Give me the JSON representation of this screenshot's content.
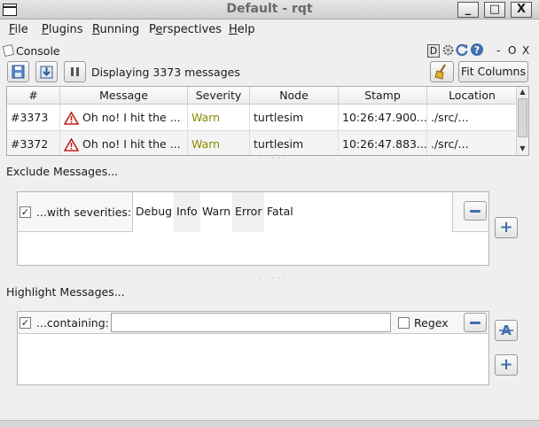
{
  "window": {
    "title": "Default - rqt",
    "minimize": "_",
    "maximize": "□",
    "close": "X"
  },
  "menu": [
    {
      "label": "File",
      "mnemonic": "F",
      "rest": "ile"
    },
    {
      "label": "Plugins",
      "mnemonic": "P",
      "rest": "lugins"
    },
    {
      "label": "Running",
      "mnemonic": "R",
      "rest": "unning"
    },
    {
      "label": "Perspectives",
      "pre": "P",
      "mnemonic": "e",
      "rest": "rspectives"
    },
    {
      "label": "Help",
      "mnemonic": "H",
      "rest": "elp"
    }
  ],
  "plugin": {
    "title": "Console",
    "d_button": "D",
    "dash": "-",
    "o": "O",
    "x": "X"
  },
  "toolbar": {
    "displaying": "Displaying 3373 messages",
    "fit_columns": "Fit Columns"
  },
  "table": {
    "columns": [
      "#",
      "Message",
      "Severity",
      "Node",
      "Stamp",
      "Location"
    ],
    "rows": [
      {
        "num": "#3373",
        "message": "Oh no! I hit the ...",
        "severity": "Warn",
        "node": "turtlesim",
        "stamp": "10:26:47.900...",
        "location": "./src/..."
      },
      {
        "num": "#3372",
        "message": "Oh no! I hit the ...",
        "severity": "Warn",
        "node": "turtlesim",
        "stamp": "10:26:47.883...",
        "location": "./src/..."
      }
    ],
    "scrollbar": {
      "up": "▲",
      "down": "▼"
    }
  },
  "exclude": {
    "title": "Exclude Messages...",
    "check": "✓",
    "label": "...with severities:",
    "severities": [
      "Debug",
      "Info",
      "Warn",
      "Error",
      "Fatal"
    ],
    "add": "+"
  },
  "highlight": {
    "title": "Highlight Messages...",
    "check": "✓",
    "label": "...containing:",
    "value": "",
    "regex": "Regex",
    "add": "+"
  },
  "colors": {
    "warn_text": "#8a8a00",
    "accent_blue": "#3f6fae",
    "warn_icon": "#c0201e"
  }
}
